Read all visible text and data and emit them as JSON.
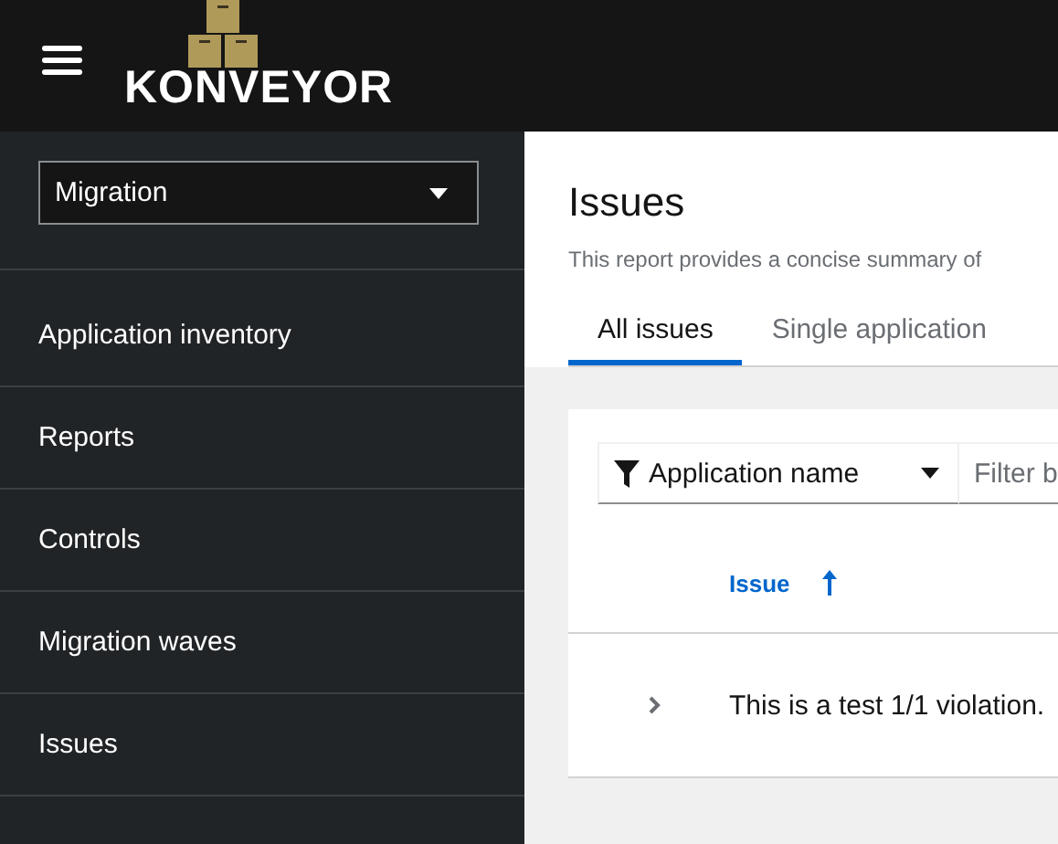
{
  "masthead": {
    "logo_text": "KONVEYOR"
  },
  "sidebar": {
    "perspective": "Migration",
    "items": [
      {
        "label": "Application inventory"
      },
      {
        "label": "Reports"
      },
      {
        "label": "Controls"
      },
      {
        "label": "Migration waves"
      },
      {
        "label": "Issues"
      }
    ]
  },
  "page": {
    "title": "Issues",
    "description": "This report provides a concise summary of",
    "tabs": [
      {
        "label": "All issues",
        "selected": true
      },
      {
        "label": "Single application",
        "selected": false
      }
    ]
  },
  "toolbar": {
    "filter_attribute": "Application name",
    "filter_placeholder": "Filter b"
  },
  "table": {
    "columns": [
      {
        "label": "Issue",
        "sort_ascending": true
      }
    ],
    "rows": [
      {
        "issue": "This is a test 1/1 violation.",
        "expanded": false
      }
    ]
  }
}
